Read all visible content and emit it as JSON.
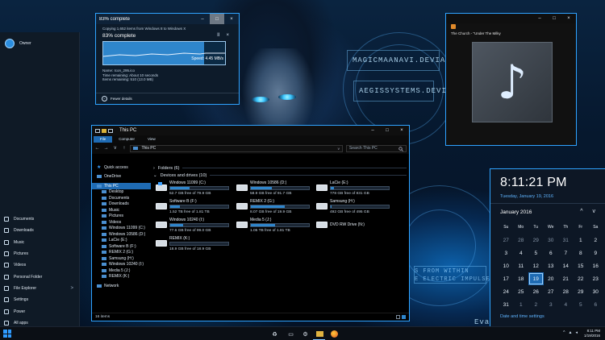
{
  "copy_dialog": {
    "title": "83% complete",
    "line1": "Copying 1,652 items from Windows 8 to Windows X",
    "percent_label": "83% complete",
    "progress_fraction": 0.83,
    "speed": "Speed: 4.45 MB/s",
    "name": "Name: Icon_295.ico",
    "time_remaining": "Time remaining: About 10 seconds",
    "items_remaining": "Items remaining: 510 (13.0 MB)",
    "fewer_details": "Fewer details",
    "pause_glyph": "II",
    "close_glyph": "×"
  },
  "media_player": {
    "title": "",
    "song": "The Church - \"Under The Milky",
    "note_glyph": "♪"
  },
  "start_menu": {
    "user": "Owner",
    "items": [
      {
        "label": "Documents",
        "icon": "document-icon",
        "chevron": ""
      },
      {
        "label": "Downloads",
        "icon": "download-icon",
        "chevron": ""
      },
      {
        "label": "Music",
        "icon": "music-icon",
        "chevron": ""
      },
      {
        "label": "Pictures",
        "icon": "pictures-icon",
        "chevron": ""
      },
      {
        "label": "Videos",
        "icon": "videos-icon",
        "chevron": ""
      },
      {
        "label": "Personal Folder",
        "icon": "folder-icon",
        "chevron": ""
      },
      {
        "label": "File Explorer",
        "icon": "file-explorer-icon",
        "chevron": ">"
      },
      {
        "label": "Settings",
        "icon": "settings-icon",
        "chevron": ""
      },
      {
        "label": "Power",
        "icon": "power-icon",
        "chevron": ""
      },
      {
        "label": "All apps",
        "icon": "all-apps-icon",
        "chevron": ""
      }
    ]
  },
  "explorer": {
    "title": "This PC",
    "tabs": [
      "File",
      "Computer",
      "View"
    ],
    "path": "This PC",
    "path_dropdown": "v",
    "search_placeholder": "Search This PC",
    "nav": {
      "back": "←",
      "forward": "→",
      "up": "↑",
      "recent": "v"
    },
    "nav_items": [
      {
        "label": "Quick access",
        "level": 0,
        "star": true
      },
      {
        "label": "OneDrive",
        "level": 0
      },
      {
        "label": "This PC",
        "level": 0,
        "selected": true
      },
      {
        "label": "Desktop",
        "level": 1
      },
      {
        "label": "Documents",
        "level": 1
      },
      {
        "label": "Downloads",
        "level": 1
      },
      {
        "label": "Music",
        "level": 1
      },
      {
        "label": "Pictures",
        "level": 1
      },
      {
        "label": "Videos",
        "level": 1
      },
      {
        "label": "Windows 11099 (C:)",
        "level": 1
      },
      {
        "label": "Windows 10586 (D:)",
        "level": 1
      },
      {
        "label": "LaCie (E:)",
        "level": 1
      },
      {
        "label": "Software B (F:)",
        "level": 1
      },
      {
        "label": "REMIX 2 (G:)",
        "level": 1
      },
      {
        "label": "Samsung (H:)",
        "level": 1
      },
      {
        "label": "Windows 10240 (I:)",
        "level": 1
      },
      {
        "label": "Media 5 (J:)",
        "level": 1
      },
      {
        "label": "REMIX (K:)",
        "level": 1
      },
      {
        "label": "Network",
        "level": 0
      }
    ],
    "folders_header": "Folders (6)",
    "devices_header": "Devices and drives (10)",
    "drives": [
      {
        "name": "Windows 11099 (C:)",
        "free": "52.7 GB free of 79.9 GB",
        "used_fraction": 0.34,
        "os": true
      },
      {
        "name": "Windows 10586 (D:)",
        "free": "58.9 GB free of 91.7 GB",
        "used_fraction": 0.36,
        "os": false
      },
      {
        "name": "LaCie (E:)",
        "free": "778 GB free of 831 GB",
        "used_fraction": 0.06,
        "os": false
      },
      {
        "name": "Software B (F:)",
        "free": "1.52 TB free of 1.81 TB",
        "used_fraction": 0.16,
        "os": false
      },
      {
        "name": "REMIX 2 (G:)",
        "free": "8.07 GB free of 19.9 GB",
        "used_fraction": 0.59,
        "os": false
      },
      {
        "name": "Samsung (H:)",
        "free": "492 GB free of 495 GB",
        "used_fraction": 0.01,
        "os": false
      },
      {
        "name": "Windows 10240 (I:)",
        "free": "77.6 GB free of 99.0 GB",
        "used_fraction": 0.22,
        "os": false
      },
      {
        "name": "Media 5 (J:)",
        "free": "1.05 TB free of 1.81 TB",
        "used_fraction": 0.42,
        "os": false
      },
      {
        "name": "DVD RW Drive (N:)",
        "free": "",
        "used_fraction": null,
        "os": false
      },
      {
        "name": "REMIX (K:)",
        "free": "18.9 GB free of 18.9 GB",
        "used_fraction": 0.0,
        "os": false
      }
    ],
    "status": "16 items"
  },
  "calendar": {
    "time": "8:11:21 PM",
    "date": "Tuesday, January 19, 2016",
    "month": "January 2016",
    "prev": "^",
    "next": "v",
    "weekdays": [
      "Su",
      "Mo",
      "Tu",
      "We",
      "Th",
      "Fr",
      "Sa"
    ],
    "days": [
      {
        "n": "27",
        "dim": true
      },
      {
        "n": "28",
        "dim": true
      },
      {
        "n": "29",
        "dim": true
      },
      {
        "n": "30",
        "dim": true
      },
      {
        "n": "31",
        "dim": true
      },
      {
        "n": "1"
      },
      {
        "n": "2"
      },
      {
        "n": "3"
      },
      {
        "n": "4"
      },
      {
        "n": "5"
      },
      {
        "n": "6"
      },
      {
        "n": "7"
      },
      {
        "n": "8"
      },
      {
        "n": "9"
      },
      {
        "n": "10"
      },
      {
        "n": "11"
      },
      {
        "n": "12"
      },
      {
        "n": "13"
      },
      {
        "n": "14"
      },
      {
        "n": "15"
      },
      {
        "n": "16"
      },
      {
        "n": "17"
      },
      {
        "n": "18"
      },
      {
        "n": "19",
        "today": true
      },
      {
        "n": "20"
      },
      {
        "n": "21"
      },
      {
        "n": "22"
      },
      {
        "n": "23"
      },
      {
        "n": "24"
      },
      {
        "n": "25"
      },
      {
        "n": "26"
      },
      {
        "n": "27"
      },
      {
        "n": "28"
      },
      {
        "n": "29"
      },
      {
        "n": "30"
      },
      {
        "n": "31"
      },
      {
        "n": "1",
        "dim": true
      },
      {
        "n": "2",
        "dim": true
      },
      {
        "n": "3",
        "dim": true
      },
      {
        "n": "4",
        "dim": true
      },
      {
        "n": "5",
        "dim": true
      },
      {
        "n": "6",
        "dim": true
      }
    ],
    "settings_link": "Date and time settings"
  },
  "wallpaper_text": {
    "line1": "MAGICMAANAVI.DEVIANTART.COM",
    "line2": "AEGISSYSTEMS.DEVIANTART.COM",
    "line3": "S FROM WITHIN",
    "line4": "E ELECTRIC IMPULSE",
    "partial": "Evalu"
  },
  "taskbar": {
    "clock_time": "8:11 PM",
    "clock_date": "1/19/2016",
    "tray_up": "^",
    "tray_icons": [
      "network-icon",
      "volume-icon",
      "chat-icon"
    ]
  },
  "window_controls": {
    "minimize": "–",
    "maximize": "□",
    "close": "×"
  },
  "colors": {
    "accent": "#2fa3ff",
    "selection": "#1f6bb3",
    "bar_fill": "#2f86cc"
  }
}
